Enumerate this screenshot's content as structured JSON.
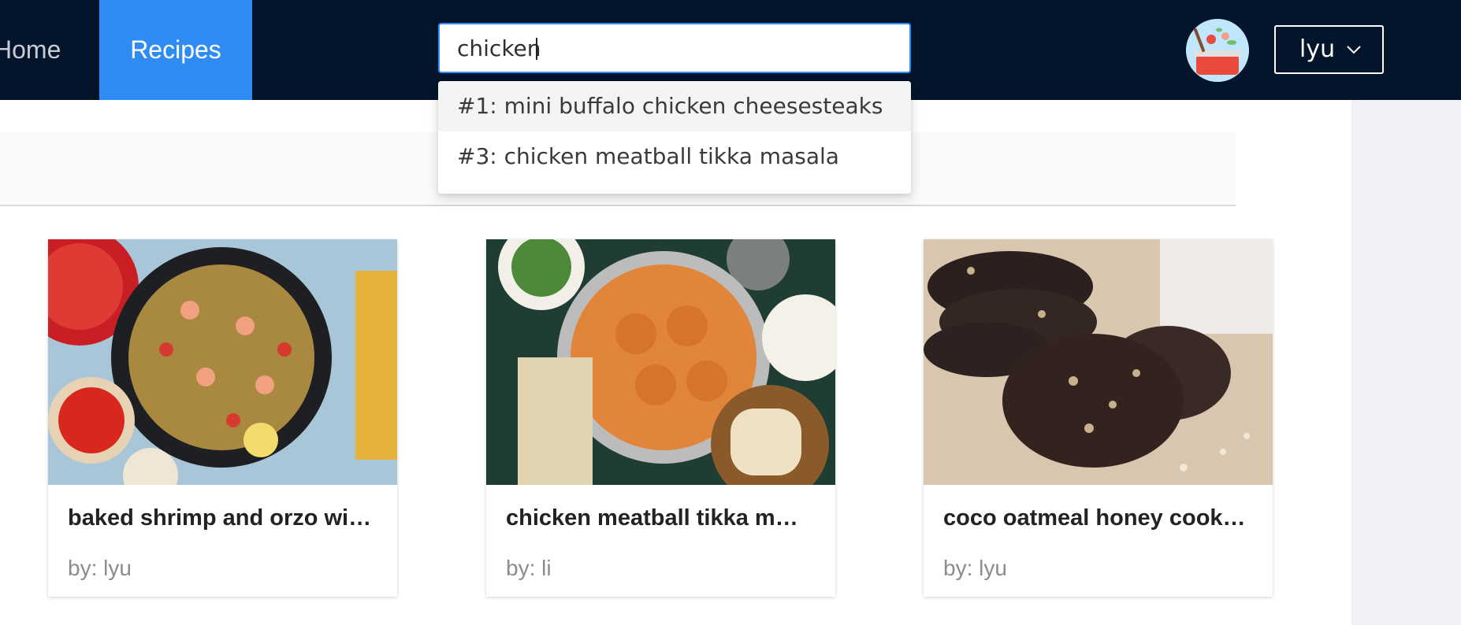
{
  "nav": {
    "home_label": "Home",
    "recipes_label": "Recipes",
    "accent_color": "#2e8cf3",
    "bar_color": "#03142b"
  },
  "search": {
    "value": "chicken",
    "suggestions": [
      {
        "label": "#1: mini buffalo chicken cheesesteaks"
      },
      {
        "label": "#3: chicken meatball tikka masala"
      }
    ]
  },
  "user": {
    "avatar_icon": "cooking-pot-icon",
    "name": "lyu",
    "menu_icon": "chevron-down-icon"
  },
  "recipes": [
    {
      "title": "baked shrimp and orzo wi…",
      "author": "by: lyu",
      "image": "shrimp-orzo-pan-photo"
    },
    {
      "title": "chicken meatball tikka m…",
      "author": "by: li",
      "image": "tikka-masala-pot-photo"
    },
    {
      "title": "coco oatmeal honey cook…",
      "author": "by: lyu",
      "image": "chocolate-cookies-photo"
    }
  ]
}
